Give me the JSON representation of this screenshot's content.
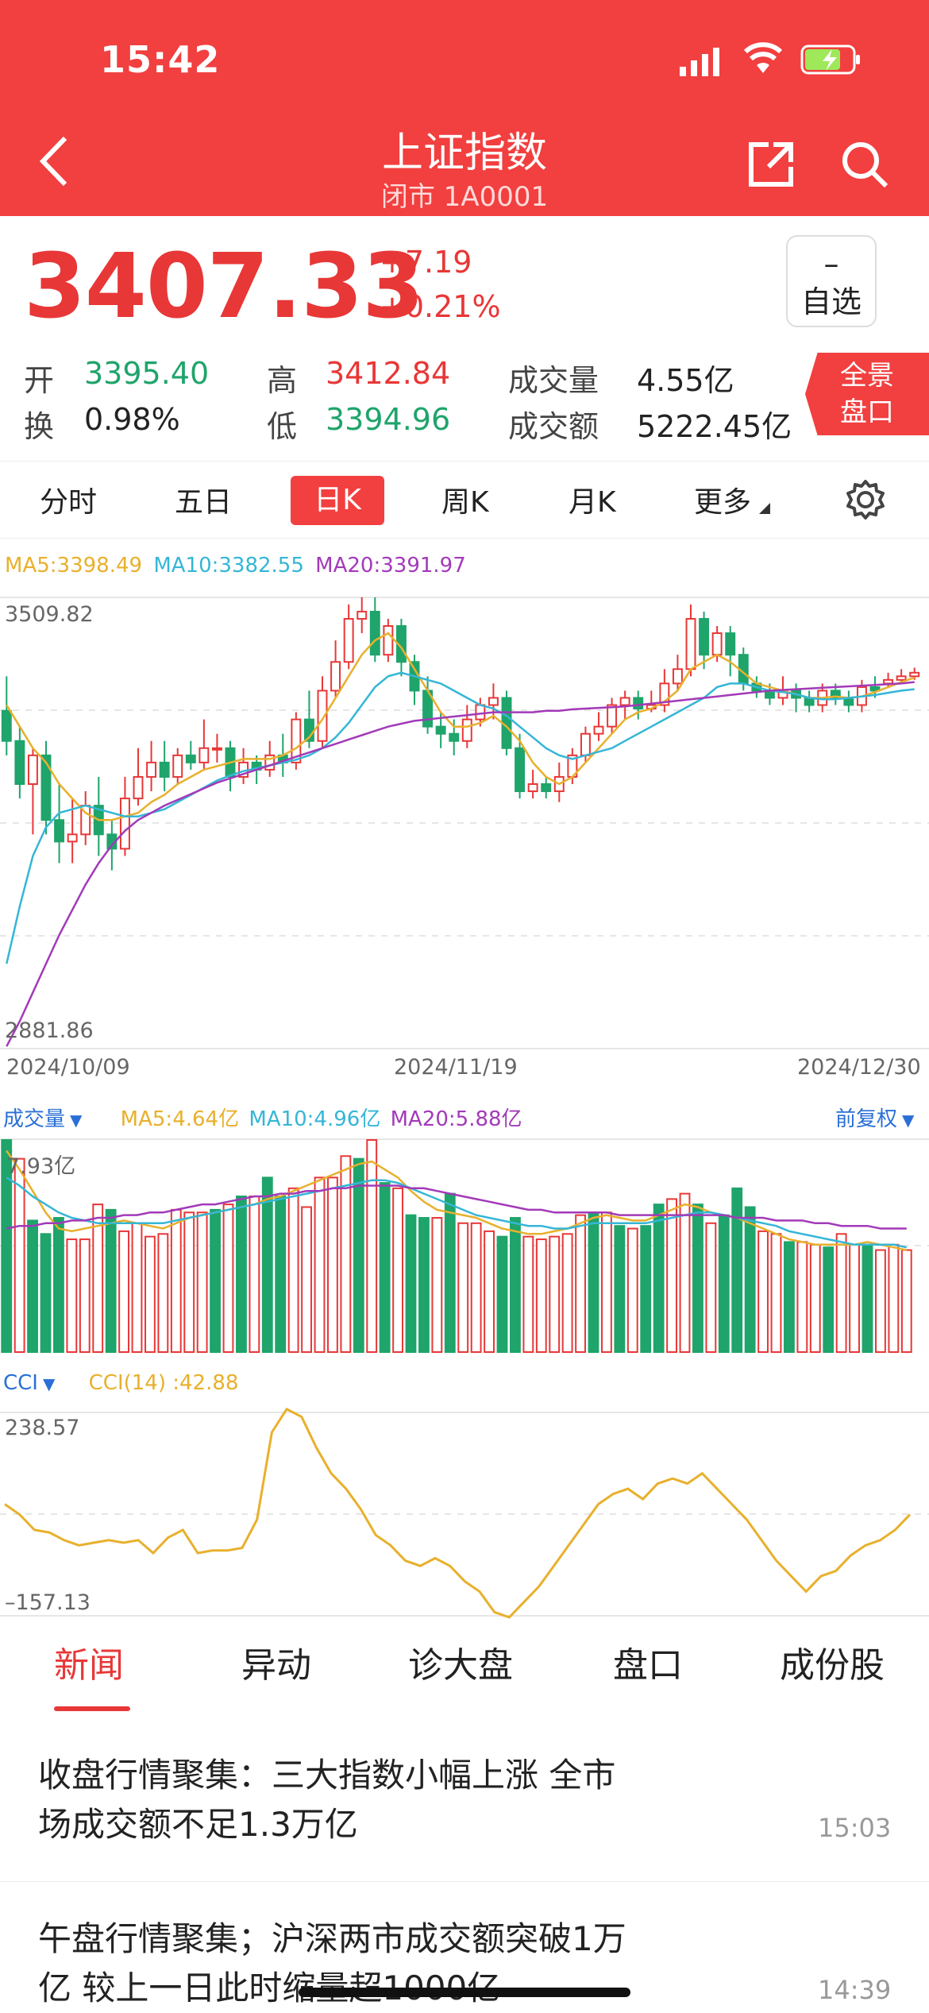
{
  "status": {
    "time": "15:42"
  },
  "header": {
    "title": "上证指数",
    "subtitle": "闭市 1A0001"
  },
  "quote": {
    "price": "3407.33",
    "change": "+7.19",
    "change_pct": "+0.21%",
    "favorite_symbol": "–",
    "favorite_label": "自选",
    "open_label": "开",
    "open": "3395.40",
    "high_label": "高",
    "high": "3412.84",
    "turnover_label": "换",
    "turnover": "0.98%",
    "low_label": "低",
    "low": "3394.96",
    "volume_label": "成交量",
    "volume": "4.55亿",
    "amount_label": "成交额",
    "amount": "5222.45亿",
    "full_label_1": "全景",
    "full_label_2": "盘口"
  },
  "chart_tabs": [
    "分时",
    "五日",
    "日K",
    "周K",
    "月K",
    "更多"
  ],
  "kline": {
    "ma5": "MA5:3398.49",
    "ma10": "MA10:3382.55",
    "ma20": "MA20:3391.97",
    "y_max_label": "3509.82",
    "y_min_label": "2881.86",
    "dates": [
      "2024/10/09",
      "2024/11/19",
      "2024/12/30"
    ]
  },
  "volume": {
    "label": "成交量",
    "ma5": "MA5:4.64亿",
    "ma10": "MA10:4.96亿",
    "ma20": "MA20:5.88亿",
    "adjust": "前复权",
    "max_label": "7.93亿"
  },
  "cci": {
    "label": "CCI",
    "value": "CCI(14) :42.88",
    "max_label": "238.57",
    "min_label": "–157.13"
  },
  "news_tabs": [
    "新闻",
    "异动",
    "诊大盘",
    "盘口",
    "成份股"
  ],
  "news": [
    {
      "line1": "收盘行情聚集：三大指数小幅上涨 全市",
      "line2": "场成交额不足1.3万亿",
      "time": "15:03"
    },
    {
      "line1": "午盘行情聚集；沪深两市成交额突破1万",
      "line2": "亿 较上一日此时缩量超1000亿",
      "time": "14:39"
    }
  ],
  "colors": {
    "brand": "#f23f3f",
    "up": "#e83737",
    "down": "#1fa46b",
    "ma5": "#e8b02c",
    "ma10": "#35b6d6",
    "ma20": "#a23ab8"
  },
  "chart_data": [
    {
      "type": "candlestick",
      "title": "日K",
      "x_labels": [
        "2024/10/09",
        "2024/11/19",
        "2024/12/30"
      ],
      "ylim": [
        2881.86,
        3509.82
      ],
      "candles": [
        [
          3352,
          3310,
          3400,
          3290
        ],
        [
          3310,
          3250,
          3330,
          3230
        ],
        [
          3250,
          3290,
          3300,
          3180
        ],
        [
          3290,
          3200,
          3310,
          3180
        ],
        [
          3200,
          3170,
          3250,
          3140
        ],
        [
          3170,
          3180,
          3230,
          3140
        ],
        [
          3180,
          3220,
          3240,
          3165
        ],
        [
          3220,
          3180,
          3260,
          3150
        ],
        [
          3180,
          3160,
          3200,
          3130
        ],
        [
          3160,
          3230,
          3260,
          3150
        ],
        [
          3230,
          3260,
          3300,
          3220
        ],
        [
          3260,
          3280,
          3310,
          3240
        ],
        [
          3280,
          3260,
          3310,
          3240
        ],
        [
          3260,
          3290,
          3300,
          3250
        ],
        [
          3290,
          3280,
          3310,
          3270
        ],
        [
          3280,
          3300,
          3340,
          3270
        ],
        [
          3300,
          3300,
          3320,
          3280
        ],
        [
          3300,
          3260,
          3310,
          3240
        ],
        [
          3260,
          3280,
          3300,
          3250
        ],
        [
          3280,
          3270,
          3290,
          3250
        ],
        [
          3270,
          3290,
          3310,
          3260
        ],
        [
          3290,
          3280,
          3320,
          3260
        ],
        [
          3280,
          3340,
          3350,
          3270
        ],
        [
          3340,
          3310,
          3380,
          3300
        ],
        [
          3310,
          3380,
          3400,
          3300
        ],
        [
          3380,
          3420,
          3450,
          3370
        ],
        [
          3420,
          3480,
          3500,
          3410
        ],
        [
          3480,
          3490,
          3510,
          3460
        ],
        [
          3490,
          3430,
          3510,
          3420
        ],
        [
          3430,
          3470,
          3480,
          3420
        ],
        [
          3470,
          3420,
          3480,
          3400
        ],
        [
          3420,
          3380,
          3430,
          3360
        ],
        [
          3380,
          3330,
          3400,
          3320
        ],
        [
          3330,
          3320,
          3350,
          3300
        ],
        [
          3320,
          3310,
          3340,
          3290
        ],
        [
          3310,
          3340,
          3360,
          3300
        ],
        [
          3340,
          3360,
          3370,
          3330
        ],
        [
          3360,
          3370,
          3390,
          3340
        ],
        [
          3370,
          3300,
          3380,
          3290
        ],
        [
          3300,
          3240,
          3320,
          3230
        ],
        [
          3240,
          3250,
          3270,
          3230
        ],
        [
          3250,
          3240,
          3260,
          3230
        ],
        [
          3240,
          3260,
          3280,
          3225
        ],
        [
          3260,
          3290,
          3300,
          3250
        ],
        [
          3290,
          3320,
          3330,
          3280
        ],
        [
          3320,
          3330,
          3350,
          3310
        ],
        [
          3330,
          3360,
          3370,
          3320
        ],
        [
          3360,
          3370,
          3380,
          3340
        ],
        [
          3370,
          3355,
          3380,
          3340
        ],
        [
          3355,
          3360,
          3380,
          3350
        ],
        [
          3360,
          3390,
          3410,
          3350
        ],
        [
          3390,
          3410,
          3430,
          3380
        ],
        [
          3410,
          3480,
          3500,
          3400
        ],
        [
          3480,
          3430,
          3490,
          3410
        ],
        [
          3430,
          3460,
          3470,
          3420
        ],
        [
          3460,
          3430,
          3470,
          3400
        ],
        [
          3430,
          3390,
          3440,
          3380
        ],
        [
          3390,
          3380,
          3400,
          3370
        ],
        [
          3380,
          3370,
          3390,
          3360
        ],
        [
          3370,
          3380,
          3400,
          3360
        ],
        [
          3380,
          3370,
          3390,
          3350
        ],
        [
          3370,
          3360,
          3380,
          3350
        ],
        [
          3360,
          3380,
          3390,
          3350
        ],
        [
          3380,
          3370,
          3390,
          3360
        ],
        [
          3370,
          3360,
          3380,
          3350
        ],
        [
          3360,
          3385,
          3395,
          3350
        ],
        [
          3385,
          3380,
          3400,
          3370
        ],
        [
          3390,
          3395,
          3405,
          3385
        ],
        [
          3395,
          3400,
          3410,
          3390
        ],
        [
          3400,
          3405,
          3412,
          3395
        ]
      ],
      "series": [
        {
          "name": "MA5",
          "values": [
            3360,
            3330,
            3300,
            3280,
            3250,
            3230,
            3210,
            3200,
            3200,
            3205,
            3210,
            3225,
            3235,
            3250,
            3260,
            3270,
            3275,
            3280,
            3285,
            3285,
            3285,
            3290,
            3300,
            3315,
            3340,
            3370,
            3400,
            3430,
            3450,
            3460,
            3440,
            3410,
            3380,
            3350,
            3330,
            3330,
            3335,
            3345,
            3330,
            3310,
            3280,
            3260,
            3250,
            3260,
            3280,
            3300,
            3320,
            3340,
            3350,
            3355,
            3365,
            3380,
            3410,
            3420,
            3430,
            3420,
            3405,
            3390,
            3385,
            3380,
            3375,
            3370,
            3370,
            3372,
            3370,
            3372,
            3378,
            3385,
            3392,
            3398
          ]
        },
        {
          "name": "MA10",
          "values": [
            3000,
            3080,
            3150,
            3190,
            3210,
            3215,
            3220,
            3215,
            3210,
            3205,
            3205,
            3210,
            3215,
            3225,
            3235,
            3245,
            3255,
            3262,
            3268,
            3272,
            3276,
            3280,
            3284,
            3290,
            3300,
            3315,
            3335,
            3360,
            3385,
            3400,
            3405,
            3400,
            3395,
            3390,
            3380,
            3370,
            3360,
            3355,
            3345,
            3330,
            3315,
            3300,
            3290,
            3285,
            3290,
            3295,
            3300,
            3310,
            3320,
            3330,
            3340,
            3350,
            3360,
            3370,
            3385,
            3390,
            3390,
            3385,
            3380,
            3378,
            3375,
            3370,
            3368,
            3368,
            3370,
            3372,
            3374,
            3377,
            3380,
            3382
          ]
        },
        {
          "name": "MA20",
          "values": [
            2885,
            2920,
            2960,
            3000,
            3040,
            3075,
            3110,
            3140,
            3165,
            3185,
            3200,
            3210,
            3220,
            3228,
            3236,
            3244,
            3252,
            3258,
            3264,
            3270,
            3276,
            3282,
            3288,
            3294,
            3300,
            3306,
            3312,
            3318,
            3324,
            3330,
            3334,
            3338,
            3340,
            3342,
            3344,
            3346,
            3348,
            3350,
            3350,
            3350,
            3350,
            3352,
            3352,
            3354,
            3355,
            3356,
            3357,
            3358,
            3360,
            3362,
            3364,
            3366,
            3368,
            3370,
            3372,
            3374,
            3376,
            3378,
            3380,
            3381,
            3382,
            3383,
            3384,
            3385,
            3386,
            3387,
            3388,
            3389,
            3390,
            3392
          ]
        }
      ]
    },
    {
      "type": "bar",
      "title": "成交量",
      "ylim": [
        0,
        7.93
      ],
      "values": [
        7.9,
        7.2,
        4.9,
        4.4,
        5.0,
        4.2,
        4.2,
        5.5,
        5.3,
        4.5,
        4.8,
        4.3,
        4.4,
        5.3,
        5.2,
        5.2,
        5.3,
        5.5,
        5.8,
        5.8,
        6.5,
        5.8,
        6.1,
        5.4,
        6.5,
        6.5,
        7.3,
        7.2,
        7.9,
        6.3,
        6.1,
        5.1,
        5.0,
        5.0,
        5.9,
        4.8,
        4.8,
        4.5,
        4.3,
        5.0,
        4.3,
        4.2,
        4.3,
        4.4,
        5.1,
        5.2,
        5.2,
        4.7,
        4.6,
        4.7,
        5.5,
        5.7,
        5.9,
        5.5,
        4.8,
        5.1,
        6.1,
        5.4,
        4.5,
        4.4,
        4.1,
        4.1,
        4.0,
        3.9,
        4.4,
        4.0,
        4.0,
        3.8,
        4.0,
        3.8
      ],
      "colors_up": [
        0,
        1,
        0,
        0,
        0,
        1,
        1,
        1,
        0,
        1,
        1,
        1,
        1,
        1,
        1,
        1,
        0,
        1,
        0,
        1,
        0,
        0,
        1,
        1,
        1,
        1,
        1,
        0,
        1,
        0,
        1,
        0,
        0,
        1,
        0,
        1,
        1,
        1,
        0,
        0,
        1,
        1,
        1,
        1,
        1,
        0,
        1,
        0,
        1,
        0,
        0,
        1,
        1,
        0,
        1,
        0,
        0,
        0,
        1,
        1,
        0,
        1,
        1,
        0,
        1,
        1,
        0,
        1,
        1,
        1
      ],
      "series": [
        {
          "name": "MA5",
          "values": [
            7.5,
            6.8,
            6.0,
            5.2,
            4.6,
            4.5,
            4.6,
            4.7,
            4.8,
            4.9,
            4.8,
            4.7,
            4.6,
            4.8,
            5.0,
            5.1,
            5.2,
            5.3,
            5.4,
            5.5,
            5.7,
            5.8,
            6.0,
            6.2,
            6.4,
            6.6,
            6.8,
            7.0,
            7.1,
            6.8,
            6.5,
            6.0,
            5.6,
            5.3,
            5.2,
            5.1,
            5.0,
            4.8,
            4.6,
            4.5,
            4.4,
            4.4,
            4.5,
            4.6,
            4.8,
            5.0,
            5.1,
            5.0,
            4.9,
            4.9,
            5.1,
            5.3,
            5.5,
            5.4,
            5.2,
            5.1,
            5.0,
            4.8,
            4.6,
            4.4,
            4.2,
            4.1,
            4.0,
            4.0,
            4.0,
            4.0,
            4.1,
            4.0,
            3.9,
            3.8
          ]
        },
        {
          "name": "MA10",
          "values": [
            6.5,
            6.2,
            5.8,
            5.5,
            5.2,
            5.0,
            4.9,
            4.8,
            4.8,
            4.8,
            4.8,
            4.8,
            4.8,
            4.9,
            5.0,
            5.1,
            5.2,
            5.3,
            5.4,
            5.5,
            5.6,
            5.7,
            5.8,
            5.9,
            6.0,
            6.1,
            6.2,
            6.3,
            6.4,
            6.4,
            6.3,
            6.1,
            5.9,
            5.7,
            5.5,
            5.3,
            5.1,
            5.0,
            4.9,
            4.8,
            4.7,
            4.7,
            4.6,
            4.6,
            4.7,
            4.8,
            4.8,
            4.8,
            4.8,
            4.8,
            4.9,
            5.0,
            5.1,
            5.2,
            5.2,
            5.1,
            5.0,
            4.9,
            4.8,
            4.7,
            4.5,
            4.4,
            4.3,
            4.2,
            4.1,
            4.0,
            4.0,
            4.0,
            4.0,
            3.9
          ]
        },
        {
          "name": "MA20",
          "values": [
            4.6,
            4.7,
            4.7,
            4.8,
            4.8,
            4.9,
            4.9,
            5.0,
            5.0,
            5.1,
            5.1,
            5.2,
            5.2,
            5.3,
            5.4,
            5.5,
            5.5,
            5.6,
            5.7,
            5.8,
            5.8,
            5.9,
            5.9,
            6.0,
            6.0,
            6.1,
            6.1,
            6.2,
            6.2,
            6.2,
            6.2,
            6.1,
            6.1,
            6.0,
            5.9,
            5.8,
            5.7,
            5.6,
            5.5,
            5.4,
            5.3,
            5.3,
            5.2,
            5.2,
            5.2,
            5.2,
            5.2,
            5.1,
            5.1,
            5.1,
            5.1,
            5.1,
            5.1,
            5.1,
            5.1,
            5.1,
            5.0,
            5.0,
            5.0,
            4.9,
            4.9,
            4.9,
            4.8,
            4.8,
            4.7,
            4.7,
            4.7,
            4.6,
            4.6,
            4.6
          ]
        }
      ]
    },
    {
      "type": "line",
      "title": "CCI(14)",
      "ylim": [
        -157.13,
        238.57
      ],
      "series": [
        {
          "name": "CCI(14)",
          "values": [
            60,
            40,
            10,
            5,
            -10,
            -20,
            -15,
            -10,
            -15,
            -10,
            -35,
            -5,
            10,
            -35,
            -30,
            -30,
            -25,
            30,
            200,
            245,
            230,
            170,
            120,
            90,
            50,
            0,
            -20,
            -50,
            -60,
            -45,
            -60,
            -90,
            -110,
            -150,
            -160,
            -130,
            -100,
            -60,
            -20,
            20,
            60,
            80,
            90,
            70,
            100,
            110,
            100,
            120,
            90,
            60,
            30,
            -10,
            -50,
            -80,
            -110,
            -80,
            -70,
            -40,
            -20,
            -10,
            10,
            40
          ]
        }
      ]
    }
  ]
}
